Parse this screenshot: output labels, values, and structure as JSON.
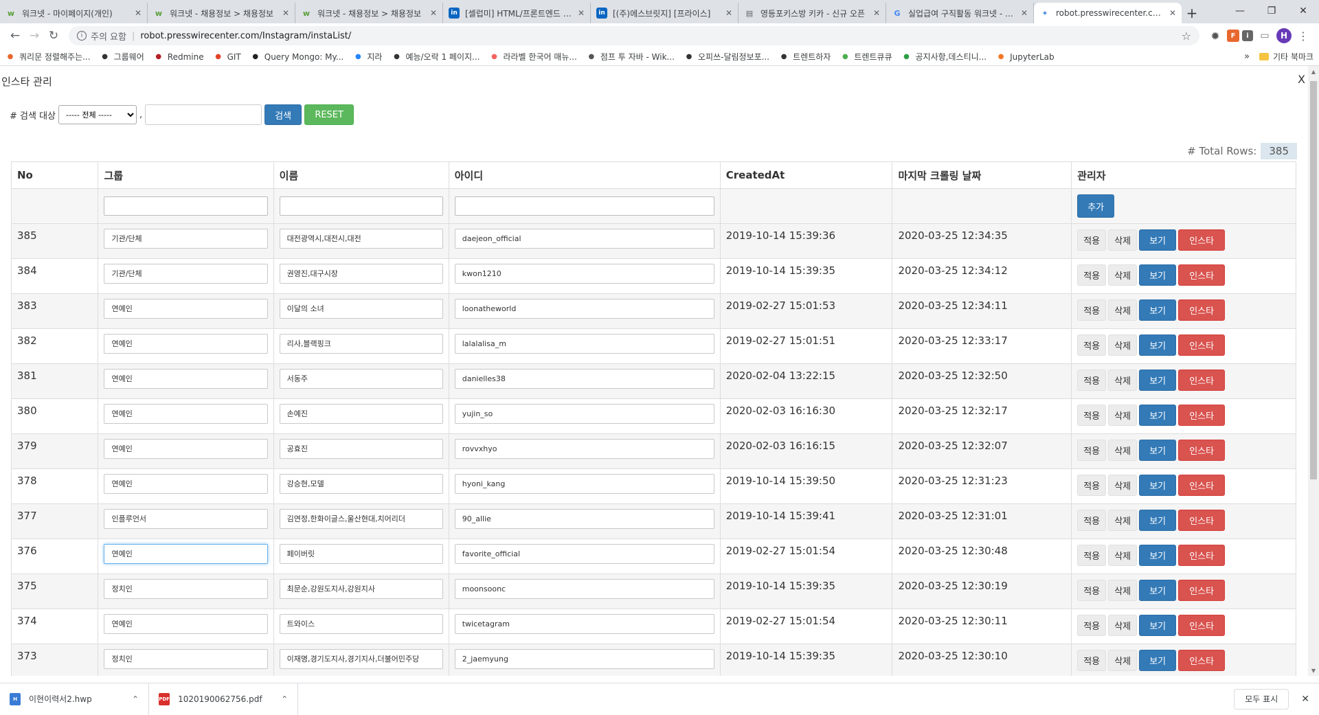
{
  "browser": {
    "tabs": [
      {
        "title": "워크넷 - 마이페이지(개인)",
        "icon": "w",
        "color": "#5a9e3a"
      },
      {
        "title": "워크넷 - 채용정보 > 채용정보",
        "icon": "w",
        "color": "#5a9e3a"
      },
      {
        "title": "워크넷 - 채용정보 > 채용정보",
        "icon": "w",
        "color": "#5a9e3a"
      },
      {
        "title": "[셀럽미] HTML/프론트엔드 개발자",
        "icon": "in",
        "color": "#0a66c2"
      },
      {
        "title": "[(주)에스브릿지] [프라이스]",
        "icon": "in",
        "color": "#0a66c2"
      },
      {
        "title": "영등포키스방 키카 - 신규 오픈",
        "icon": "doc",
        "color": "#5f6368"
      },
      {
        "title": "실업급여 구직활동 워크넷 - Goo",
        "icon": "G",
        "color": "#4285f4"
      },
      {
        "title": "robot.presswirecenter.com/Ins",
        "icon": "robot",
        "color": "#4a8fd8"
      }
    ],
    "new_tab_label": "+",
    "address": {
      "security": "주의 요함",
      "url": "robot.presswirecenter.com/Instagram/instaList/"
    },
    "profile_initial": "H",
    "bookmarks": [
      {
        "label": "쿼리문 정렬해주는...",
        "icon_color": "#e8672e"
      },
      {
        "label": "그룹웨어",
        "icon_color": "#333"
      },
      {
        "label": "Redmine",
        "icon_color": "#b32024"
      },
      {
        "label": "GIT",
        "icon_color": "#e24329"
      },
      {
        "label": "Query Mongo: My...",
        "icon_color": "#222"
      },
      {
        "label": "지라",
        "icon_color": "#2684ff"
      },
      {
        "label": "예능/오락 1 페이지...",
        "icon_color": "#333"
      },
      {
        "label": "라라벨 한국어 매뉴...",
        "icon_color": "#f4645f"
      },
      {
        "label": "점프 투 자바 - Wik...",
        "icon_color": "#555"
      },
      {
        "label": "오피쓰-달림정보포...",
        "icon_color": "#333"
      },
      {
        "label": "트렌트하자",
        "icon_color": "#333"
      },
      {
        "label": "트렌트큐큐",
        "icon_color": "#4caf50"
      },
      {
        "label": "공지사항,데스티니...",
        "icon_color": "#2e9e44"
      },
      {
        "label": "JupyterLab",
        "icon_color": "#f37626"
      }
    ],
    "bookmarks_more": "»",
    "other_bookmarks": "기타 북마크"
  },
  "page": {
    "title": "인스타 관리",
    "close_label": "X",
    "search": {
      "label": "# 검색 대상",
      "select_value": "----- 전체 -----",
      "comma": ",",
      "input_value": "",
      "search_button": "검색",
      "reset_button": "RESET"
    },
    "total_label": "# Total Rows:",
    "total_rows": "385",
    "columns": [
      "No",
      "그룹",
      "이름",
      "아이디",
      "CreatedAt",
      "마지막 크롤링 날짜",
      "관리자"
    ],
    "add_button": "추가",
    "action_labels": {
      "apply": "적용",
      "delete": "삭제",
      "view": "보기",
      "insta": "인스타"
    },
    "rows": [
      {
        "no": "385",
        "group": "기관/단체",
        "name": "대전광역시,대전시,대전",
        "id": "daejeon_official",
        "created": "2019-10-14 15:39:36",
        "crawled": "2020-03-25 12:34:35"
      },
      {
        "no": "384",
        "group": "기관/단체",
        "name": "권영진,대구시장",
        "id": "kwon1210",
        "created": "2019-10-14 15:39:35",
        "crawled": "2020-03-25 12:34:12"
      },
      {
        "no": "383",
        "group": "연예인",
        "name": "이달의 소녀",
        "id": "loonatheworld",
        "created": "2019-02-27 15:01:53",
        "crawled": "2020-03-25 12:34:11"
      },
      {
        "no": "382",
        "group": "연예인",
        "name": "리사,블랙핑크",
        "id": "lalalalisa_m",
        "created": "2019-02-27 15:01:51",
        "crawled": "2020-03-25 12:33:17"
      },
      {
        "no": "381",
        "group": "연예인",
        "name": "서동주",
        "id": "danielles38",
        "created": "2020-02-04 13:22:15",
        "crawled": "2020-03-25 12:32:50"
      },
      {
        "no": "380",
        "group": "연예인",
        "name": "손예진",
        "id": "yujin_so",
        "created": "2020-02-03 16:16:30",
        "crawled": "2020-03-25 12:32:17"
      },
      {
        "no": "379",
        "group": "연예인",
        "name": "공효진",
        "id": "rovvxhyo",
        "created": "2020-02-03 16:16:15",
        "crawled": "2020-03-25 12:32:07"
      },
      {
        "no": "378",
        "group": "연예인",
        "name": "강승현,모델",
        "id": "hyoni_kang",
        "created": "2019-10-14 15:39:50",
        "crawled": "2020-03-25 12:31:23"
      },
      {
        "no": "377",
        "group": "인플루언서",
        "name": "김연정,한화이글스,울산현대,치어리더",
        "id": "90_allie",
        "created": "2019-10-14 15:39:41",
        "crawled": "2020-03-25 12:31:01"
      },
      {
        "no": "376",
        "group": "연예인",
        "name": "페이버릿",
        "id": "favorite_official",
        "created": "2019-02-27 15:01:54",
        "crawled": "2020-03-25 12:30:48"
      },
      {
        "no": "375",
        "group": "정치인",
        "name": "최문순,강원도지사,강원지사",
        "id": "moonsoonc",
        "created": "2019-10-14 15:39:35",
        "crawled": "2020-03-25 12:30:19"
      },
      {
        "no": "374",
        "group": "연예인",
        "name": "트와이스",
        "id": "twicetagram",
        "created": "2019-02-27 15:01:54",
        "crawled": "2020-03-25 12:30:11"
      },
      {
        "no": "373",
        "group": "정치인",
        "name": "이재명,경기도지사,경기지사,더불어민주당",
        "id": "2_jaemyung",
        "created": "2019-10-14 15:39:35",
        "crawled": "2020-03-25 12:30:10"
      }
    ]
  },
  "downloads": {
    "items": [
      {
        "name": "이현이력서2.hwp",
        "type": "hwp"
      },
      {
        "name": "1020190062756.pdf",
        "type": "pdf"
      }
    ],
    "show_all": "모두 표시",
    "close_label": "✕"
  }
}
